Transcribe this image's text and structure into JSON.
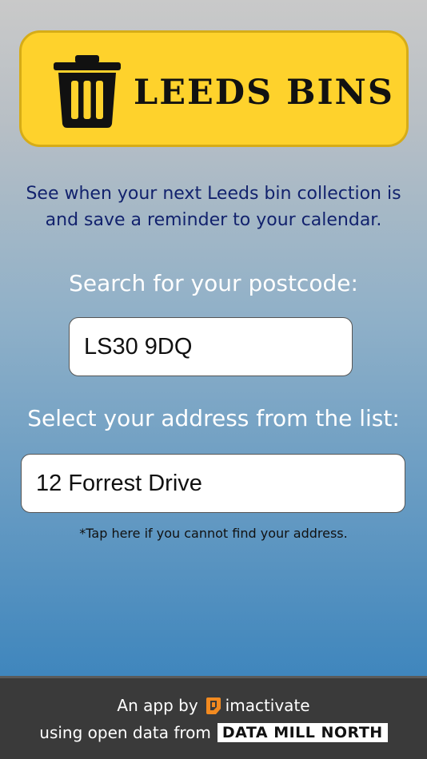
{
  "app": {
    "title": "LEEDS BINS"
  },
  "intro": {
    "line1": "See when your next Leeds bin collection is",
    "line2": "and save a reminder to your calendar."
  },
  "postcode": {
    "label": "Search for your postcode:",
    "value": "LS30 9DQ"
  },
  "address": {
    "label": "Select your address from the list:",
    "value": "12 Forrest Drive"
  },
  "help": {
    "link_text": "*Tap here if you cannot find your address."
  },
  "footer": {
    "by_text": "An app by",
    "brand": "imactivate",
    "data_text": "using open data from",
    "data_source": "DATA MILL NORTH"
  },
  "colors": {
    "banner": "#fed22c",
    "banner_border": "#d6ac17",
    "intro_text": "#12226d",
    "footer_bg": "#3a3a3a",
    "brand_accent": "#f28a20"
  },
  "icons": {
    "logo": "trash-bin-icon",
    "brand": "imactivate-logo-icon"
  }
}
